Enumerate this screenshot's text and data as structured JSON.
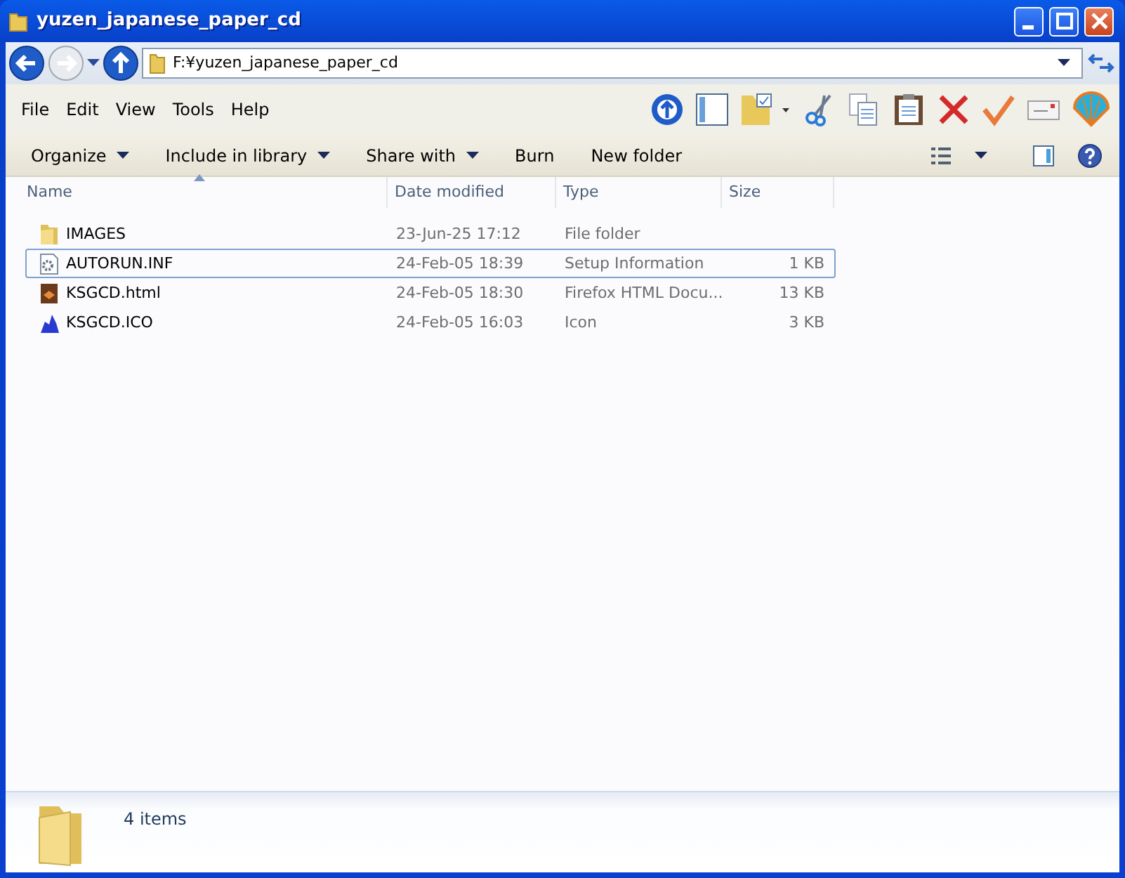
{
  "window": {
    "title": "yuzen_japanese_paper_cd"
  },
  "address": {
    "path": "F:¥yuzen_japanese_paper_cd"
  },
  "menu": [
    "File",
    "Edit",
    "View",
    "Tools",
    "Help"
  ],
  "commands": [
    {
      "label": "Organize",
      "dropdown": true
    },
    {
      "label": "Include in library",
      "dropdown": true
    },
    {
      "label": "Share with",
      "dropdown": true
    },
    {
      "label": "Burn",
      "dropdown": false
    },
    {
      "label": "New folder",
      "dropdown": false
    }
  ],
  "table": {
    "columns": [
      "Name",
      "Date modified",
      "Type",
      "Size"
    ],
    "rows": [
      {
        "kind": "folder",
        "name": "IMAGES",
        "date": "23-Jun-25 17:12",
        "type": "File folder",
        "size": "",
        "selected": false
      },
      {
        "kind": "setup",
        "name": "AUTORUN.INF",
        "date": "24-Feb-05 18:39",
        "type": "Setup Information",
        "size": "1 KB",
        "selected": true
      },
      {
        "kind": "html",
        "name": "KSGCD.html",
        "date": "24-Feb-05 18:30",
        "type": "Firefox HTML Docu...",
        "size": "13 KB",
        "selected": false
      },
      {
        "kind": "ico",
        "name": "KSGCD.ICO",
        "date": "24-Feb-05 16:03",
        "type": "Icon",
        "size": "3 KB",
        "selected": false
      }
    ]
  },
  "status_bar": {
    "count": "4 items"
  }
}
